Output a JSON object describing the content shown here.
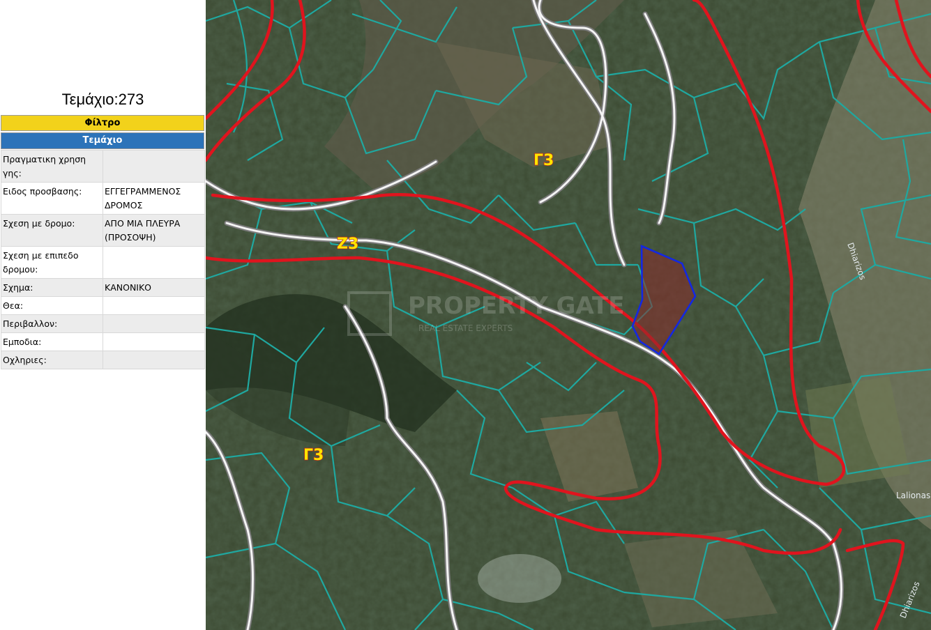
{
  "panel": {
    "title": "Τεμάχιο:273",
    "filter_label": "Φίλτρο",
    "section_label": "Τεμάχιο",
    "rows": [
      {
        "label": "Πραγματικη χρηση γης:",
        "value": ""
      },
      {
        "label": "Ειδος προσβασης:",
        "value": "ΕΓΓΕΓΡΑΜΜΕΝΟΣ ΔΡΟΜΟΣ"
      },
      {
        "label": "Σχεση με δρομο:",
        "value": "ΑΠΟ ΜΙΑ ΠΛΕΥΡΑ (ΠΡΟΣΟΨΗ)"
      },
      {
        "label": "Σχεση με επιπεδο δρομου:",
        "value": ""
      },
      {
        "label": "Σχημα:",
        "value": "ΚΑΝΟΝΙΚΟ"
      },
      {
        "label": "Θεα:",
        "value": ""
      },
      {
        "label": "Περιβαλλον:",
        "value": ""
      },
      {
        "label": "Εμποδια:",
        "value": ""
      },
      {
        "label": "Οχληριες:",
        "value": ""
      }
    ]
  },
  "map": {
    "zone_labels": [
      "Γ3",
      "Ζ3",
      "Γ3"
    ],
    "place_labels": [
      "Dhiarizos",
      "Lalionas",
      "Dhiarizos"
    ],
    "watermark": {
      "main": "PROPERTY GATE",
      "sub": "REAL ESTATE EXPERTS"
    },
    "colors": {
      "filter_bar": "#f2d21b",
      "section_bar": "#2c73b9",
      "zone_boundary": "#e0141e",
      "parcel_lines": "#1fa8a0",
      "selected_parcel": "#1428e0",
      "roads": "#f4f4f4",
      "zone_label": "#ffe600"
    }
  }
}
